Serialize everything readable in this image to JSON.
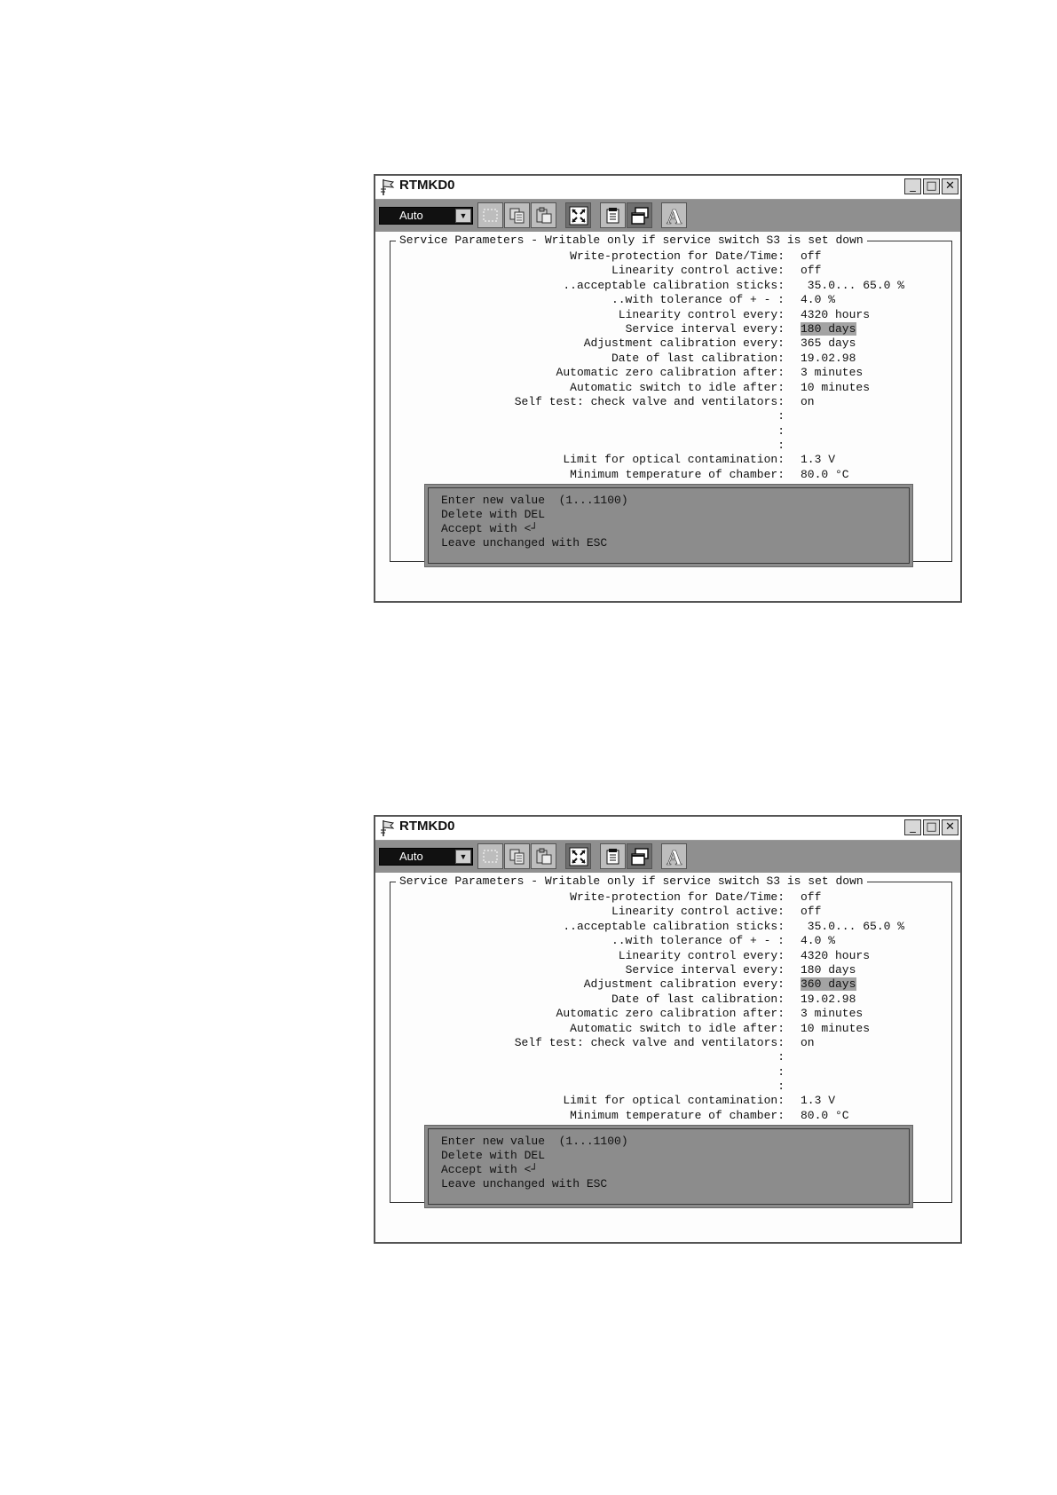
{
  "windows": [
    {
      "title": "RTMKD0",
      "window_buttons": {
        "minimize": "_",
        "maximize": "□",
        "close": "✕"
      },
      "mode_select": {
        "value": "Auto",
        "arrow": "▼"
      },
      "toolbar_icons": [
        "select-icon",
        "copy-icon",
        "paste-icon",
        "fit-icon",
        "notes-icon",
        "restore-icon",
        "font-icon"
      ],
      "frame_title": "Service Parameters - Writable only if service switch S3 is set down",
      "rows": [
        {
          "label": "Write-protection for Date/Time:",
          "value": "off"
        },
        {
          "label": "Linearity control active:",
          "value": "off"
        },
        {
          "label": "..acceptable calibration sticks:",
          "value": " 35.0... 65.0 %"
        },
        {
          "label": "..with tolerance of + - :",
          "value": "4.0 %"
        },
        {
          "label": "Linearity control every:",
          "value": "4320 hours"
        },
        {
          "label": "Service interval every:",
          "value": "180 days",
          "highlight": true
        },
        {
          "label": "Adjustment calibration every:",
          "value": "365 days"
        },
        {
          "label": "Date of last calibration:",
          "value": "19.02.98"
        },
        {
          "label": "Automatic zero calibration after:",
          "value": "3 minutes"
        },
        {
          "label": "Automatic switch to idle after:",
          "value": "10 minutes"
        },
        {
          "label": "Self test: check valve and ventilators:",
          "value": "on"
        },
        {
          "label": ":",
          "value": ""
        },
        {
          "label": ":",
          "value": ""
        },
        {
          "label": ":",
          "value": ""
        },
        {
          "label": "Limit for optical contamination:",
          "value": "1.3 V"
        },
        {
          "label": "Minimum temperature of chamber:",
          "value": "80.0 °C"
        }
      ],
      "dialog": [
        "Enter new value  (1...1100)",
        "Delete with DEL",
        "Accept with <┘",
        "Leave unchanged with ESC"
      ]
    },
    {
      "title": "RTMKD0",
      "window_buttons": {
        "minimize": "_",
        "maximize": "□",
        "close": "✕"
      },
      "mode_select": {
        "value": "Auto",
        "arrow": "▼"
      },
      "toolbar_icons": [
        "select-icon",
        "copy-icon",
        "paste-icon",
        "fit-icon",
        "notes-icon",
        "restore-icon",
        "font-icon"
      ],
      "frame_title": "Service Parameters - Writable only if service switch S3 is set down",
      "rows": [
        {
          "label": "Write-protection for Date/Time:",
          "value": "off"
        },
        {
          "label": "Linearity control active:",
          "value": "off"
        },
        {
          "label": "..acceptable calibration sticks:",
          "value": " 35.0... 65.0 %"
        },
        {
          "label": "..with tolerance of + - :",
          "value": "4.0 %"
        },
        {
          "label": "Linearity control every:",
          "value": "4320 hours"
        },
        {
          "label": "Service interval every:",
          "value": "180 days"
        },
        {
          "label": "Adjustment calibration every:",
          "value": "360 days",
          "highlight": true
        },
        {
          "label": "Date of last calibration:",
          "value": "19.02.98"
        },
        {
          "label": "Automatic zero calibration after:",
          "value": "3 minutes"
        },
        {
          "label": "Automatic switch to idle after:",
          "value": "10 minutes"
        },
        {
          "label": "Self test: check valve and ventilators:",
          "value": "on"
        },
        {
          "label": ":",
          "value": ""
        },
        {
          "label": ":",
          "value": ""
        },
        {
          "label": ":",
          "value": ""
        },
        {
          "label": "Limit for optical contamination:",
          "value": "1.3 V"
        },
        {
          "label": "Minimum temperature of chamber:",
          "value": "80.0 °C"
        }
      ],
      "dialog": [
        "Enter new value  (1...1100)",
        "Delete with DEL",
        "Accept with <┘",
        "Leave unchanged with ESC"
      ]
    }
  ]
}
